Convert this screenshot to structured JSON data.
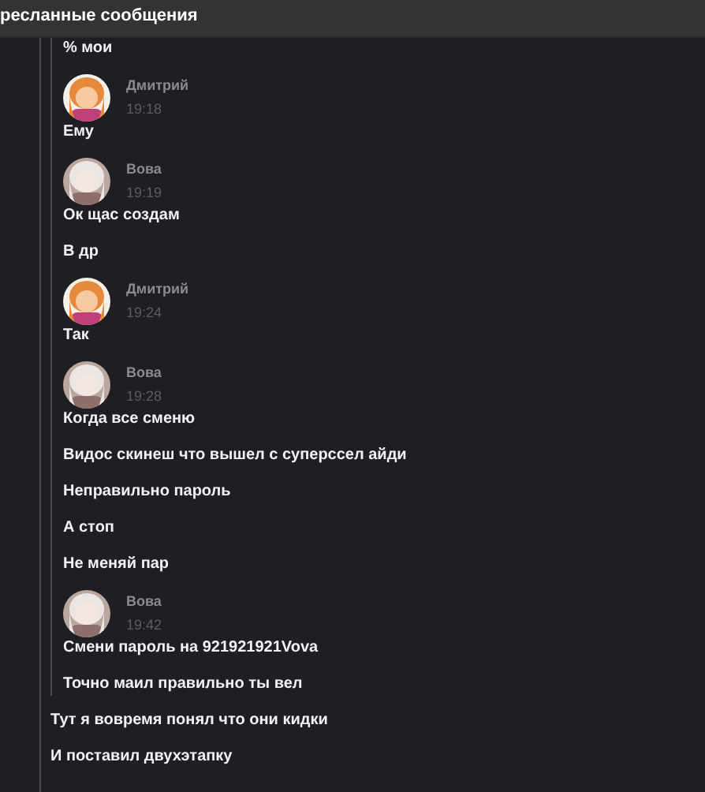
{
  "header": {
    "title": "ресланные сообщения"
  },
  "quoted_messages": [
    {
      "kind": "text",
      "text": "% мои"
    },
    {
      "kind": "author",
      "name": "Дмитрий",
      "time": "19:18"
    },
    {
      "kind": "text",
      "text": "Ему"
    },
    {
      "kind": "author",
      "name": "Вова",
      "time": "19:19"
    },
    {
      "kind": "text",
      "text": "Ок щас создам"
    },
    {
      "kind": "text",
      "text": "В др"
    },
    {
      "kind": "author",
      "name": "Дмитрий",
      "time": "19:24"
    },
    {
      "kind": "text",
      "text": "Так"
    },
    {
      "kind": "author",
      "name": "Вова",
      "time": "19:28"
    },
    {
      "kind": "text",
      "text": "Когда все сменю"
    },
    {
      "kind": "text",
      "text": "Видос скинеш что вышел с суперссел айди"
    },
    {
      "kind": "text",
      "text": "Неправильно пароль"
    },
    {
      "kind": "text",
      "text": "А стоп"
    },
    {
      "kind": "text",
      "text": "Не меняй пар"
    },
    {
      "kind": "author",
      "name": "Вова",
      "time": "19:42"
    },
    {
      "kind": "text",
      "text": "Смени пароль на 921921921Vova"
    },
    {
      "kind": "text",
      "text": "Точно маил правильно ты вел"
    }
  ],
  "messages": [
    {
      "kind": "text",
      "text": "Тут я вовремя понял что они кидки"
    },
    {
      "kind": "text",
      "text": "И поставил двухэтапку"
    }
  ]
}
